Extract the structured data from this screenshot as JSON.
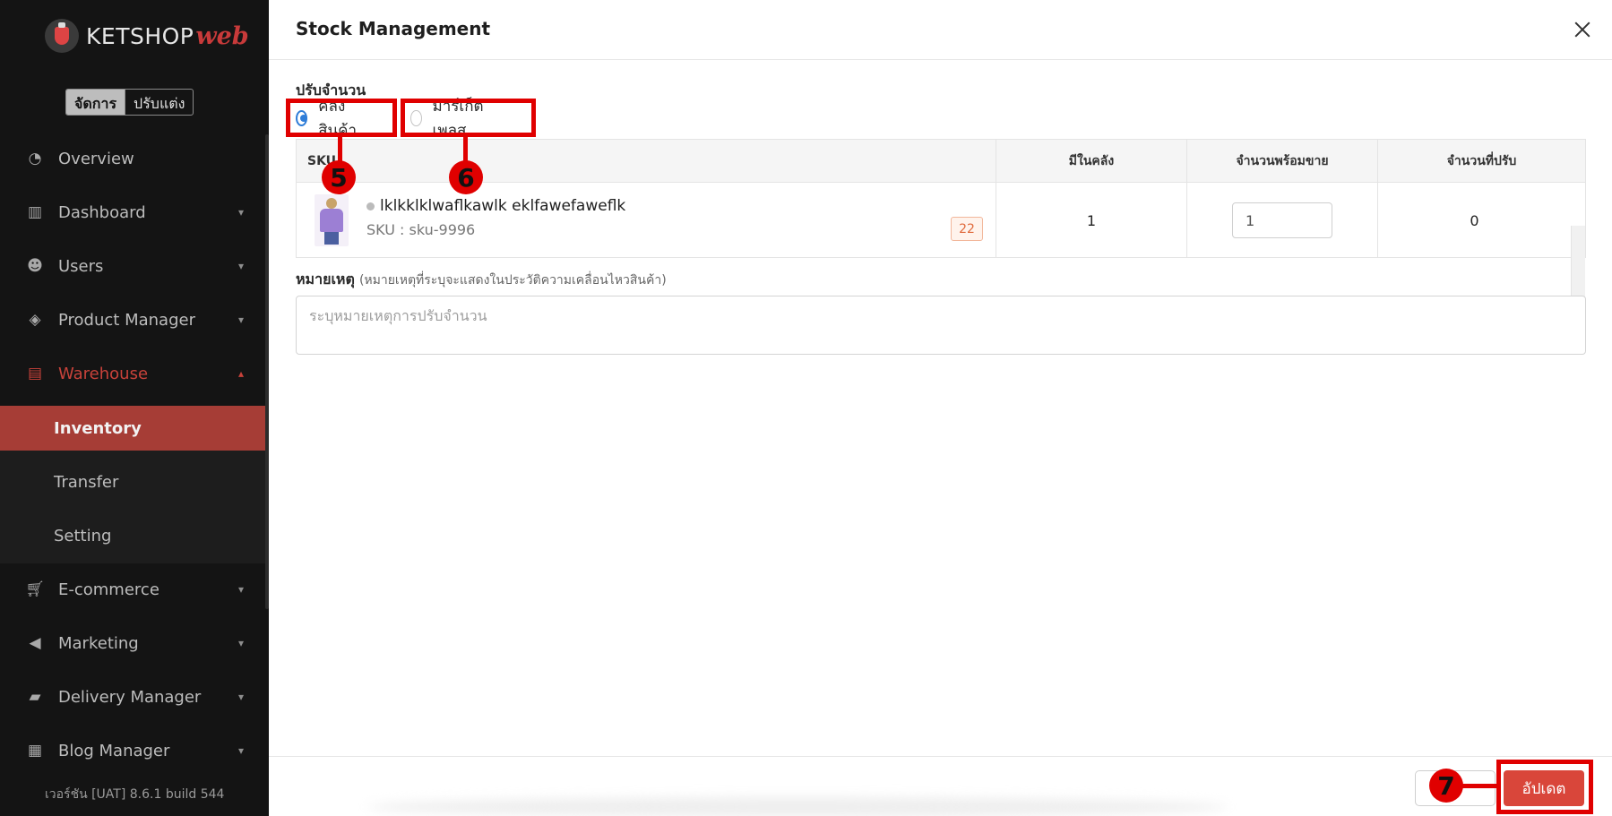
{
  "sidebar": {
    "logo_text": "KETSHOP",
    "logo_accent": "web",
    "mode_active": "จัดการ",
    "mode_inactive": "ปรับแต่ง",
    "items": [
      {
        "label": "Overview",
        "icon": "pie-chart-icon"
      },
      {
        "label": "Dashboard",
        "icon": "bar-chart-icon"
      },
      {
        "label": "Users",
        "icon": "users-icon"
      },
      {
        "label": "Product Manager",
        "icon": "tag-icon"
      },
      {
        "label": "Warehouse",
        "icon": "warehouse-icon"
      },
      {
        "label": "E-commerce",
        "icon": "cart-icon"
      },
      {
        "label": "Marketing",
        "icon": "megaphone-icon"
      },
      {
        "label": "Delivery Manager",
        "icon": "truck-icon"
      },
      {
        "label": "Blog Manager",
        "icon": "newspaper-icon"
      }
    ],
    "warehouse_sub": [
      "Inventory",
      "Transfer",
      "Setting"
    ],
    "version": "เวอร์ชัน [UAT] 8.6.1 build 544",
    "accent_color": "#c8423a"
  },
  "modal": {
    "title": "Stock Management",
    "adjust_label": "ปรับจำนวน",
    "radio_warehouse": "คลังสินค้า",
    "radio_marketplace": "มาร์เก็ตเพลส",
    "columns": [
      "SKU",
      "มีในคลัง",
      "จำนวนพร้อมขาย",
      "จำนวนที่ปรับ"
    ],
    "row": {
      "product_name": "lklkklklwaflkawlk eklfawefaweflk",
      "sku": "SKU : sku-9996",
      "badge": "22",
      "in_stock": "1",
      "ready_qty": "1",
      "adjust_qty": "0"
    },
    "note_label": "หมายเหตุ",
    "note_hint": "(หมายเหตุที่ระบุจะแสดงในประวัติความเคลื่อนไหวสินค้า)",
    "note_placeholder": "ระบุหมายเหตุการปรับจำนวน",
    "update_label": "อัปเดต",
    "update_color": "#d9463a"
  },
  "annotations": {
    "marker_5": "5",
    "marker_6": "6",
    "marker_7": "7",
    "highlight_color": "#e00000"
  }
}
